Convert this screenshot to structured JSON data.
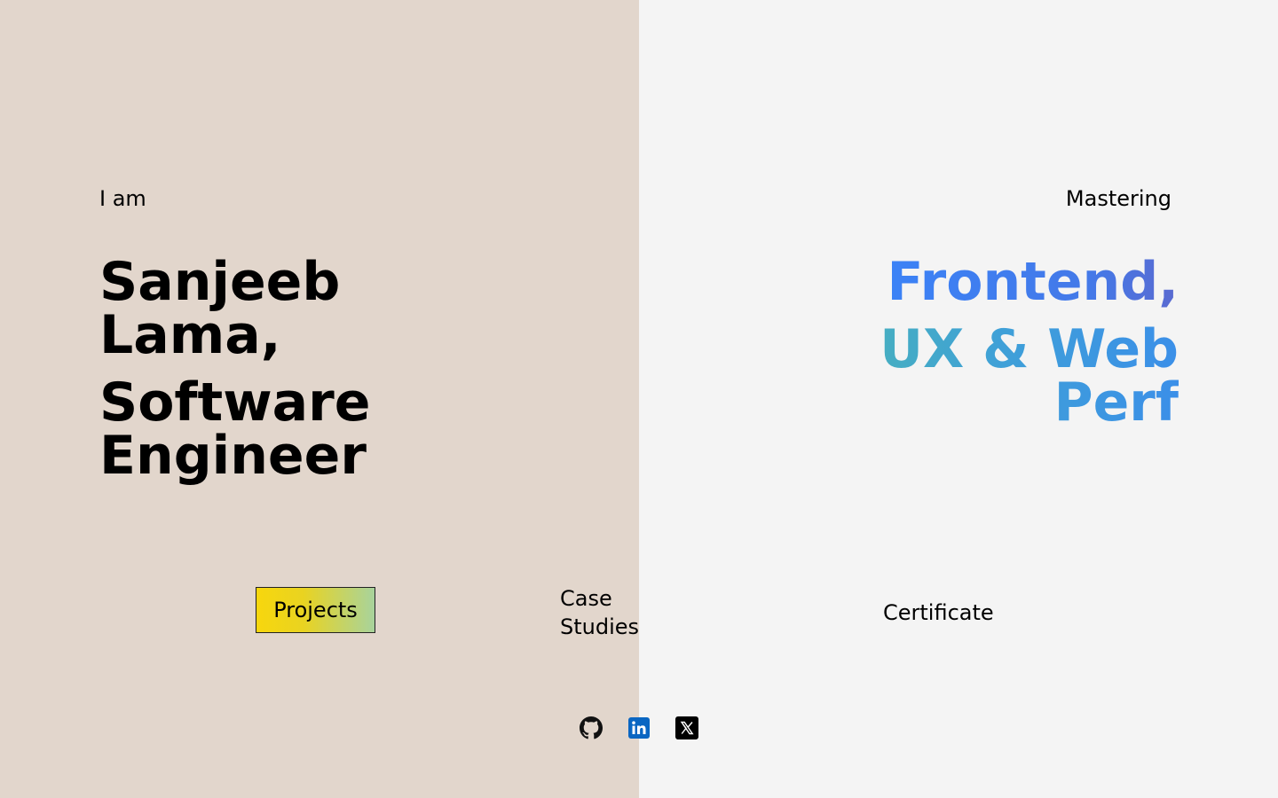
{
  "intro": {
    "label": "I am",
    "name": "Sanjeeb Lama,",
    "role": "Software Engineer"
  },
  "skills": {
    "label": "Mastering",
    "line1": "Frontend,",
    "line2a": "UX & Web",
    "line2b": "Perf"
  },
  "nav": {
    "projects_label": "Projects",
    "case_studies_label": "Case Studies",
    "certificate_label": "Certificate"
  },
  "social": [
    {
      "name": "github-icon"
    },
    {
      "name": "linkedin-icon"
    },
    {
      "name": "x-icon"
    }
  ],
  "colors": {
    "left_bg": "#e2d6cc",
    "right_bg": "#f4f4f4",
    "gradient_blue": "#3b82f6",
    "gradient_teal": "#3fb7a8",
    "button_yellow": "#f7d70d",
    "button_green": "#a8d39c",
    "linkedin_blue": "#0a66c2"
  }
}
